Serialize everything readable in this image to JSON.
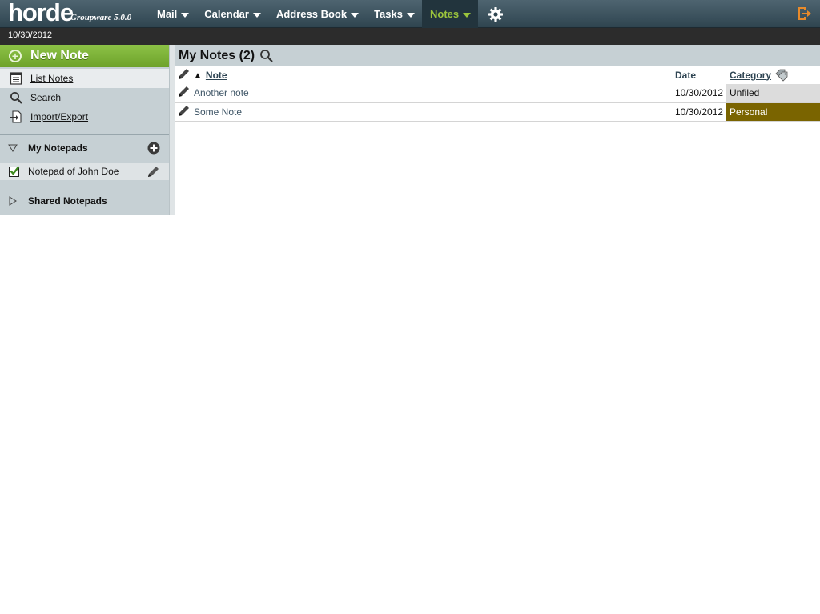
{
  "app": {
    "logo_text": "horde",
    "logo_sub": "Groupware 5.0.0"
  },
  "nav": {
    "items": [
      {
        "label": "Mail",
        "active": false
      },
      {
        "label": "Calendar",
        "active": false
      },
      {
        "label": "Address Book",
        "active": false
      },
      {
        "label": "Tasks",
        "active": false
      },
      {
        "label": "Notes",
        "active": true
      }
    ],
    "settings_icon": "gear-icon",
    "logout_icon": "logout-icon"
  },
  "datebar": {
    "date": "10/30/2012"
  },
  "sidebar": {
    "new_note_label": "New Note",
    "links": [
      {
        "label": "List Notes",
        "icon": "list-icon",
        "selected": true
      },
      {
        "label": "Search",
        "icon": "search-icon",
        "selected": false
      },
      {
        "label": "Import/Export",
        "icon": "import-export-icon",
        "selected": false
      }
    ],
    "my_notepads_label": "My Notepads",
    "notepad": {
      "label": "Notepad of John Doe",
      "checked": true
    },
    "shared_notepads_label": "Shared Notepads"
  },
  "main": {
    "title": "My Notes (2)",
    "columns": {
      "note": "Note",
      "date": "Date",
      "category": "Category"
    },
    "rows": [
      {
        "title": "Another note",
        "date": "10/30/2012",
        "category": "Unfiled",
        "category_bg": "#dcdcdc",
        "category_color": "#111111"
      },
      {
        "title": "Some Note",
        "date": "10/30/2012",
        "category": "Personal",
        "category_bg": "#7a6400",
        "category_color": "#ffffff"
      }
    ]
  },
  "colors": {
    "accent_green": "#8cc246",
    "nav_active_text": "#9bc43c",
    "topbar": "#3d535e",
    "sidebar_bg": "#c6d0d4"
  }
}
